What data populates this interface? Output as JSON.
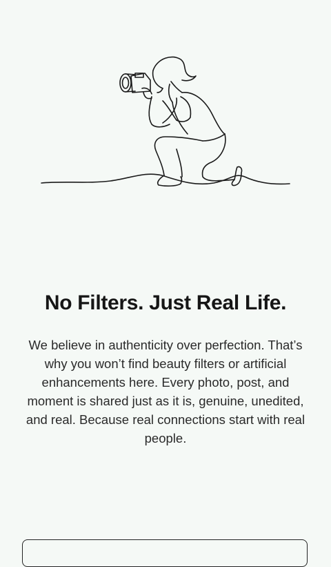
{
  "onboarding": {
    "title": "No Filters. Just Real Life.",
    "description": "We believe in authenticity over perfection. That’s why you won’t find beauty filters or artificial enhancements here. Every photo, post, and moment is shared just as it is, genuine, unedited, and real. Because real connections start with real people.",
    "illustration_icon": "photographer-kneeling-icon"
  },
  "colors": {
    "background": "#f5f9f6",
    "text": "#161616",
    "line_art": "#1a1a1a"
  }
}
